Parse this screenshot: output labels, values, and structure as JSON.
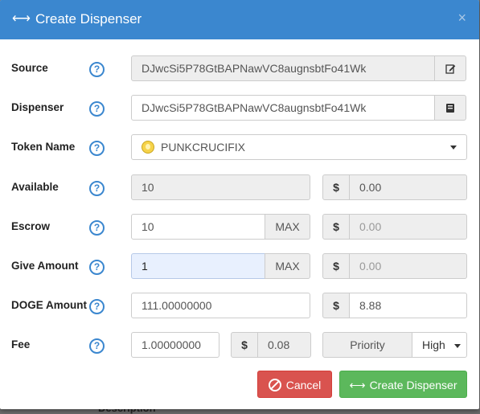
{
  "dialog": {
    "title": "Create Dispenser",
    "close_label": "×"
  },
  "fields": {
    "source": {
      "label": "Source",
      "value": "DJwcSi5P78GtBAPNawVC8augnsbtFo41Wk"
    },
    "dispenser": {
      "label": "Dispenser",
      "value": "DJwcSi5P78GtBAPNawVC8augnsbtFo41Wk"
    },
    "token_name": {
      "label": "Token Name",
      "value": "PUNKCRUCIFIX"
    },
    "available": {
      "label": "Available",
      "value": "10",
      "usd_symbol": "$",
      "usd_value": "0.00"
    },
    "escrow": {
      "label": "Escrow",
      "value": "10",
      "max_label": "MAX",
      "usd_symbol": "$",
      "usd_value": "0.00"
    },
    "give_amount": {
      "label": "Give Amount",
      "value": "1",
      "max_label": "MAX",
      "usd_symbol": "$",
      "usd_value": "0.00"
    },
    "doge_amount": {
      "label": "DOGE Amount",
      "value": "111.00000000",
      "usd_symbol": "$",
      "usd_value": "8.88"
    },
    "fee": {
      "label": "Fee",
      "value": "1.00000000",
      "usd_symbol": "$",
      "usd_value": "0.08",
      "priority_label": "Priority",
      "priority_value": "High"
    }
  },
  "help_glyph": "?",
  "buttons": {
    "cancel": "Cancel",
    "create": "Create Dispenser"
  },
  "backdrop_text": "Description",
  "colors": {
    "header": "#3b87cf",
    "cancel": "#d9534f",
    "create": "#5cb85c"
  }
}
